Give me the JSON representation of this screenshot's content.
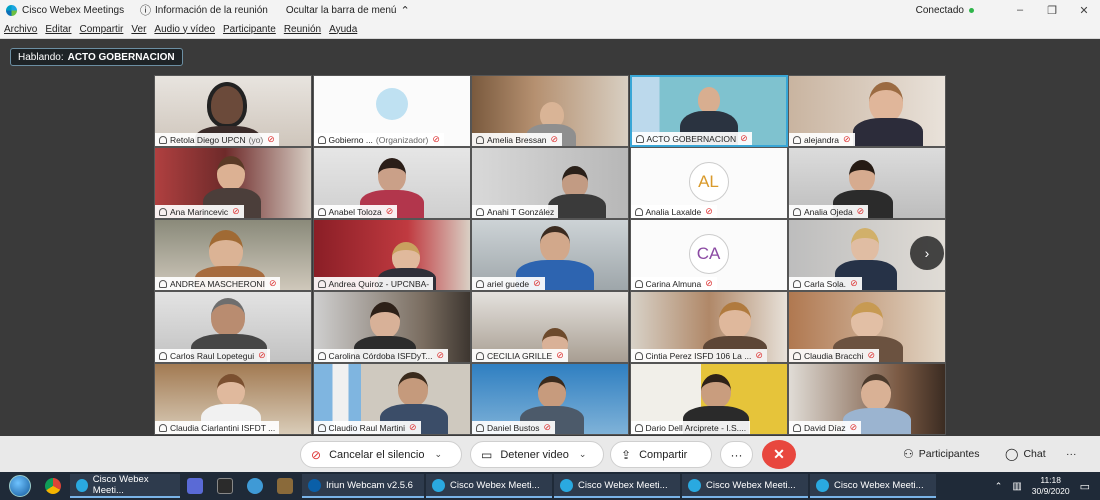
{
  "titlebar": {
    "app_title": "Cisco Webex Meetings",
    "meeting_info": "Información de la reunión",
    "hide_menu": "Ocultar la barra de menú",
    "status": "Conectado",
    "minimize": "–",
    "restore": "❐",
    "close": "✕"
  },
  "menubar": [
    "Archivo",
    "Editar",
    "Compartir",
    "Ver",
    "Audio y vídeo",
    "Participante",
    "Reunión",
    "Ayuda"
  ],
  "speaking": {
    "label": "Hablando:",
    "name": "ACTO GOBERNACION"
  },
  "tiles": [
    {
      "name": "Retola Diego UPCN",
      "role": "(yo)"
    },
    {
      "name": "Gobierno ...",
      "role": "(Organizador)"
    },
    {
      "name": "Amelia Bressan",
      "role": ""
    },
    {
      "name": "ACTO GOBERNACION",
      "role": ""
    },
    {
      "name": "alejandra",
      "role": ""
    },
    {
      "name": "Ana Marincevic",
      "role": ""
    },
    {
      "name": "Anabel Toloza",
      "role": ""
    },
    {
      "name": "Anahi T González",
      "role": ""
    },
    {
      "name": "Analia Laxalde",
      "role": "",
      "initials": "AL"
    },
    {
      "name": "Analia Ojeda",
      "role": ""
    },
    {
      "name": "ANDREA MASCHERONI",
      "role": ""
    },
    {
      "name": "Andrea Quiroz - UPCNBA-",
      "role": ""
    },
    {
      "name": "ariel guede",
      "role": ""
    },
    {
      "name": "Carina Almuna",
      "role": "",
      "initials": "CA"
    },
    {
      "name": "Carla Sola.",
      "role": ""
    },
    {
      "name": "Carlos Raul Lopetegui",
      "role": ""
    },
    {
      "name": "Carolina Córdoba ISFDyT...",
      "role": ""
    },
    {
      "name": "CECILIA GRILLE",
      "role": ""
    },
    {
      "name": "Cintia Perez ISFD 106 La ...",
      "role": ""
    },
    {
      "name": "Claudia Bracchi",
      "role": ""
    },
    {
      "name": "Claudia Ciarlantini ISFDT ...",
      "role": ""
    },
    {
      "name": "Claudio Raul Martini",
      "role": ""
    },
    {
      "name": "Daniel Bustos",
      "role": ""
    },
    {
      "name": "Dario Dell Arciprete - I.S....",
      "role": ""
    },
    {
      "name": "David Díaz",
      "role": ""
    }
  ],
  "controls": {
    "mute": "Cancelar el silencio",
    "video": "Detener video",
    "share": "Compartir",
    "more": "···",
    "end": "✕",
    "participants": "Participantes",
    "chat": "Chat",
    "more_right": "···"
  },
  "taskbar": {
    "apps": [
      "Cisco Webex Meeti...",
      "Iriun Webcam v2.5.6",
      "Cisco Webex Meeti...",
      "Cisco Webex Meeti...",
      "Cisco Webex Meeti...",
      "Cisco Webex Meeti..."
    ],
    "time": "11:18",
    "date": "30/9/2020"
  }
}
